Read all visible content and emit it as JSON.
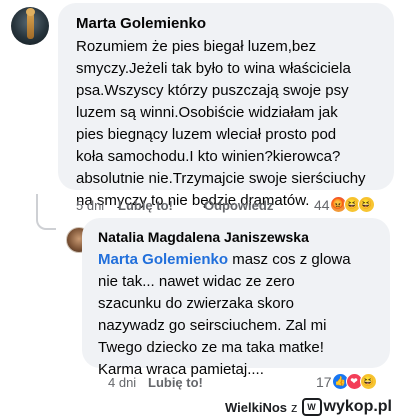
{
  "comment": {
    "author": "Marta Golemienko",
    "lines": [
      "Rozumiem że pies biegał luzem,bez",
      "smyczy.Jeżeli tak było to wina właściciela",
      "psa.Wszyscy którzy puszczają swoje psy",
      "luzem są winni.Osobiście widziałam jak",
      "pies biegnący luzem wleciał prosto pod",
      "koła samochodu.I kto winien?kierowca?",
      "absolutnie nie.Trzymajcie swoje sierściuchy",
      "na smyczy to nie będzie dramatów."
    ],
    "time": "5 dni",
    "like_label": "Lubię to!",
    "reply_label": "Odpowiedz",
    "reaction_count": "44",
    "reaction_icons": [
      "angry-icon",
      "haha-icon",
      "haha-icon"
    ]
  },
  "reply": {
    "author": "Natalia Magdalena Janiszewska",
    "mention": "Marta Golemienko",
    "first_line_rest": " masz cos z glowa",
    "lines": [
      "nie tak... nawet widac ze zero",
      "szacunku do zwierzaka skoro",
      "nazywadz go seirsciuchem. Zal mi",
      "Twego dziecko ze ma taka matke!",
      "Karma wraca pamietaj...."
    ],
    "time": "4 dni",
    "like_label": "Lubię to!",
    "reaction_count": "17",
    "reaction_icons": [
      "like-icon",
      "love-icon",
      "haha-icon"
    ]
  },
  "watermark": {
    "author": "WielkiNos",
    "connector": "z",
    "site": "wykop.pl"
  }
}
